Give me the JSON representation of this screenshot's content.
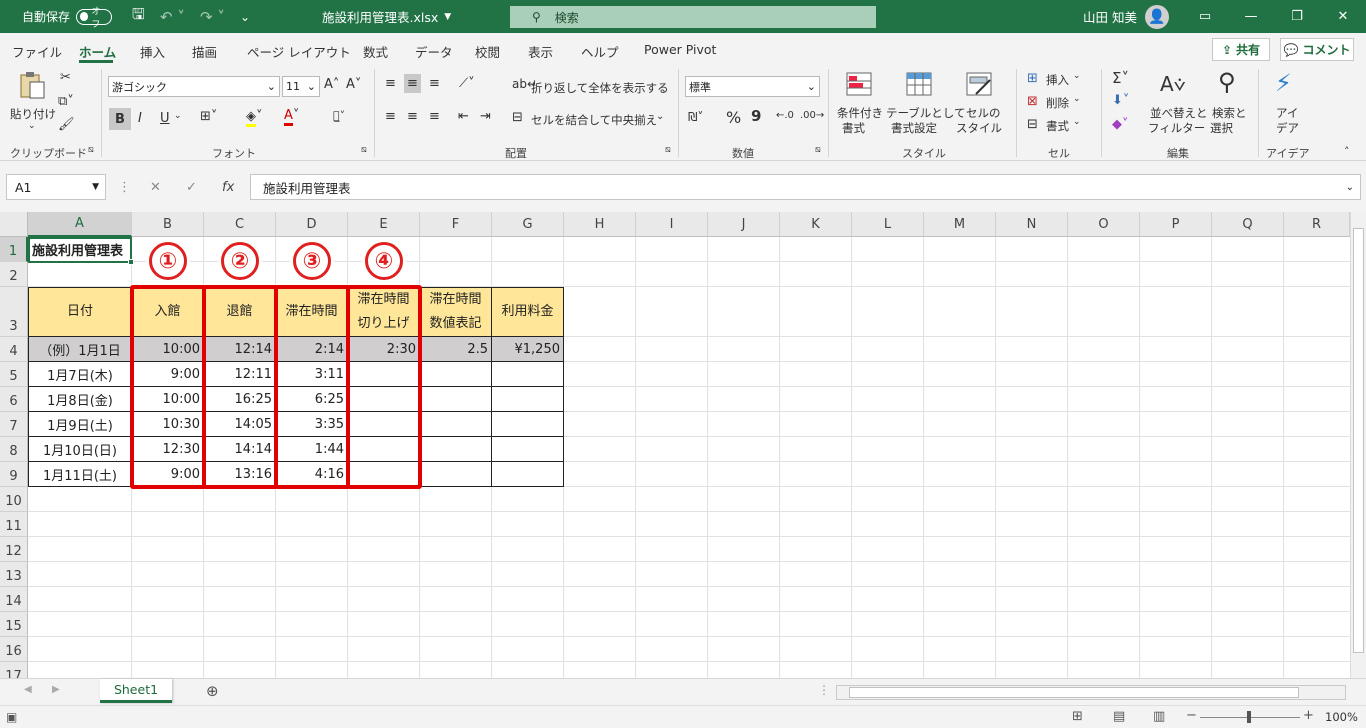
{
  "titlebar": {
    "autosave_label": "自動保存",
    "autosave_state": "オフ",
    "filename": "施設利用管理表.xlsx",
    "search_placeholder": "検索",
    "user_name": "山田 知美"
  },
  "menu": {
    "tabs": [
      "ファイル",
      "ホーム",
      "挿入",
      "描画",
      "ページ レイアウト",
      "数式",
      "データ",
      "校閲",
      "表示",
      "ヘルプ",
      "Power Pivot"
    ],
    "share_label": "共有",
    "comment_label": "コメント"
  },
  "ribbon": {
    "clipboard": {
      "paste_label": "貼り付け",
      "group_label": "クリップボード"
    },
    "font": {
      "font_name": "游ゴシック",
      "font_size": "11",
      "bold": "B",
      "italic": "I",
      "underline": "U",
      "group_label": "フォント"
    },
    "alignment": {
      "wrap_label": "折り返して全体を表示する",
      "merge_label": "セルを結合して中央揃え",
      "group_label": "配置"
    },
    "number": {
      "format": "標準",
      "percent": "%",
      "comma": "9",
      "group_label": "数値"
    },
    "styles": {
      "conditional_label": [
        "条件付き",
        "書式"
      ],
      "table_label": [
        "テーブルとして",
        "書式設定"
      ],
      "cell_style_label": [
        "セルの",
        "スタイル"
      ],
      "group_label": "スタイル"
    },
    "cells": {
      "insert_label": "挿入",
      "delete_label": "削除",
      "format_label": "書式",
      "group_label": "セル"
    },
    "editing": {
      "sort_label": [
        "並べ替えと",
        "フィルター"
      ],
      "find_label": [
        "検索と",
        "選択"
      ],
      "group_label": "編集"
    },
    "ideas": {
      "label": [
        "アイ",
        "デア"
      ],
      "group_label": "アイデア"
    }
  },
  "formula_bar": {
    "name_box": "A1",
    "fx": "fx",
    "content": "施設利用管理表"
  },
  "sheet": {
    "columns": [
      "A",
      "B",
      "C",
      "D",
      "E",
      "F",
      "G",
      "H",
      "I",
      "J",
      "K",
      "L",
      "M",
      "N",
      "O",
      "P",
      "Q",
      "R"
    ],
    "rows": [
      "1",
      "2",
      "3",
      "4",
      "5",
      "6",
      "7",
      "8",
      "9",
      "10",
      "11",
      "12",
      "13",
      "14",
      "15",
      "16",
      "17"
    ],
    "title": "施設利用管理表",
    "headers": [
      "日付",
      "入館",
      "退館",
      "滞在時間",
      "滞在時間\n切り上げ",
      "滞在時間\n数値表記",
      "利用料金"
    ],
    "example_row": [
      "（例）1月1日",
      "10:00",
      "12:14",
      "2:14",
      "2:30",
      "2.5",
      "¥1,250"
    ],
    "data_rows": [
      [
        "1月7日(木)",
        "9:00",
        "12:11",
        "3:11"
      ],
      [
        "1月8日(金)",
        "10:00",
        "16:25",
        "6:25"
      ],
      [
        "1月9日(土)",
        "10:30",
        "14:05",
        "3:35"
      ],
      [
        "1月10日(日)",
        "12:30",
        "14:14",
        "1:44"
      ],
      [
        "1月11日(土)",
        "9:00",
        "13:16",
        "4:16"
      ]
    ],
    "annotations": [
      "①",
      "②",
      "③",
      "④"
    ]
  },
  "tabs_bar": {
    "sheet_name": "Sheet1"
  },
  "statusbar": {
    "zoom": "100%"
  },
  "colors": {
    "accent": "#217346",
    "header_fill": "#ffe699",
    "example_fill": "#d0cece",
    "annotation_red": "#e00000"
  }
}
